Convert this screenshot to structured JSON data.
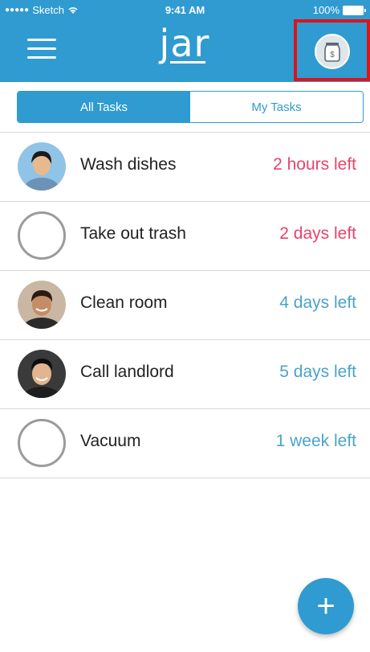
{
  "status_bar": {
    "carrier": "Sketch",
    "time": "9:41 AM",
    "battery": "100%"
  },
  "header": {
    "logo_text": "jar",
    "menu_icon": "hamburger-menu-icon",
    "jar_icon": "money-jar-icon"
  },
  "tabs": [
    {
      "label": "All Tasks",
      "active": true
    },
    {
      "label": "My Tasks",
      "active": false
    }
  ],
  "tasks": [
    {
      "name": "Wash dishes",
      "time_left": "2 hours left",
      "status_color": "#e8436a",
      "assignee": "woman-avatar"
    },
    {
      "name": "Take out trash",
      "time_left": "2 days left",
      "status_color": "#e8436a",
      "assignee": "unassigned"
    },
    {
      "name": "Clean room",
      "time_left": "4 days left",
      "status_color": "#4aa3c8",
      "assignee": "man-avatar"
    },
    {
      "name": "Call landlord",
      "time_left": "5 days left",
      "status_color": "#4aa3c8",
      "assignee": "man-avatar"
    },
    {
      "name": "Vacuum",
      "time_left": "1 week left",
      "status_color": "#4aa3c8",
      "assignee": "unassigned"
    }
  ],
  "fab": {
    "label": "+",
    "icon": "plus-icon"
  },
  "colors": {
    "primary": "#2f9bd0",
    "urgent": "#e8436a",
    "normal": "#4aa3c8",
    "highlight_box": "#e0121b"
  }
}
